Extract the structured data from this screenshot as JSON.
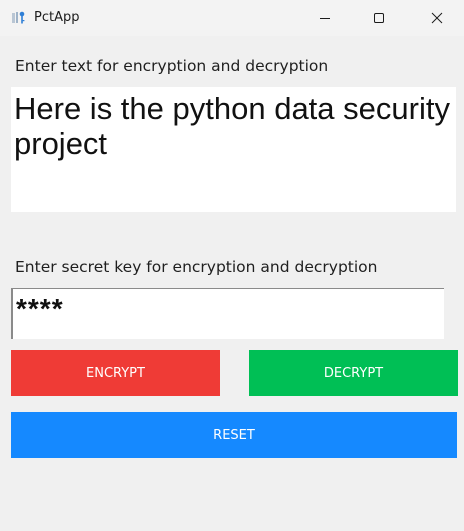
{
  "window": {
    "title": "PctApp",
    "icon": "key-icon",
    "controls": {
      "minimize": "minimize-icon",
      "maximize": "maximize-icon",
      "close": "close-icon"
    }
  },
  "form": {
    "text_label": "Enter text for encryption and decryption",
    "text_value": "Here is the python data security project",
    "key_label": "Enter secret key for encryption and decryption",
    "key_value": "****"
  },
  "buttons": {
    "encrypt": "ENCRYPT",
    "decrypt": "DECRYPT",
    "reset": "RESET"
  },
  "colors": {
    "encrypt": "#ef3b36",
    "decrypt": "#00bf55",
    "reset": "#1589ff",
    "background": "#f0f0f0"
  }
}
